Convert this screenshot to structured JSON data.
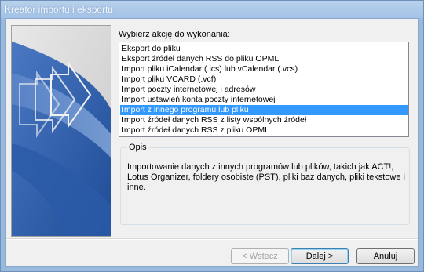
{
  "window": {
    "title": "Kreator importu i eksportu"
  },
  "wizard": {
    "prompt": "Wybierz akcję do wykonania:",
    "actions": [
      "Eksport do pliku",
      "Eksport źródeł danych RSS do pliku OPML",
      "Import pliku iCalendar (.ics) lub vCalendar (.vcs)",
      "Import pliku VCARD (.vcf)",
      "Import poczty internetowej i adresów",
      "Import ustawień konta poczty internetowej",
      "Import z innego programu lub pliku",
      "Import źródeł danych RSS z listy wspólnych źródeł",
      "Import źródeł danych RSS z pliku OPML"
    ],
    "selected_action": "Import z innego programu lub pliku",
    "description_label": "Opis",
    "description_text": "Importowanie danych z innych programów lub plików, takich jak ACT!, Lotus Organizer, foldery osobiste (PST), pliki baz danych, pliki tekstowe i inne."
  },
  "buttons": {
    "back": "< Wstecz",
    "next": "Dalej >",
    "cancel": "Anuluj"
  },
  "colors": {
    "titlebar": "#a3c2e5",
    "selection": "#3399ff",
    "dialog_bg": "#f0f0f0"
  }
}
